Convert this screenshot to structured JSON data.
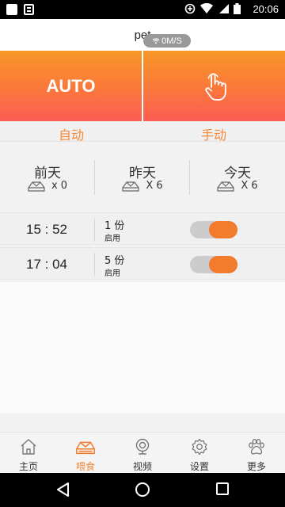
{
  "status_bar": {
    "time": "20:06"
  },
  "header": {
    "title": "pet",
    "speed": "0M/S"
  },
  "modes": {
    "auto_button": "AUTO",
    "auto_label": "自动",
    "manual_label": "手动"
  },
  "stats": [
    {
      "day": "前天",
      "count": "x 0"
    },
    {
      "day": "昨天",
      "count": "X 6"
    },
    {
      "day": "今天",
      "count": "X 6"
    }
  ],
  "schedule": [
    {
      "time": "15 : 52",
      "portion": "1 份",
      "status": "启用",
      "enabled": true
    },
    {
      "time": "17 : 04",
      "portion": "5 份",
      "status": "启用",
      "enabled": true
    }
  ],
  "tabs": [
    {
      "label": "主页",
      "icon": "home-icon"
    },
    {
      "label": "喂食",
      "icon": "feed-icon",
      "active": true
    },
    {
      "label": "视频",
      "icon": "camera-icon"
    },
    {
      "label": "设置",
      "icon": "gear-icon"
    },
    {
      "label": "更多",
      "icon": "paw-icon"
    }
  ],
  "colors": {
    "accent": "#f37b2c",
    "gradient_top": "#f89726",
    "gradient_bottom": "#fd5d54"
  }
}
